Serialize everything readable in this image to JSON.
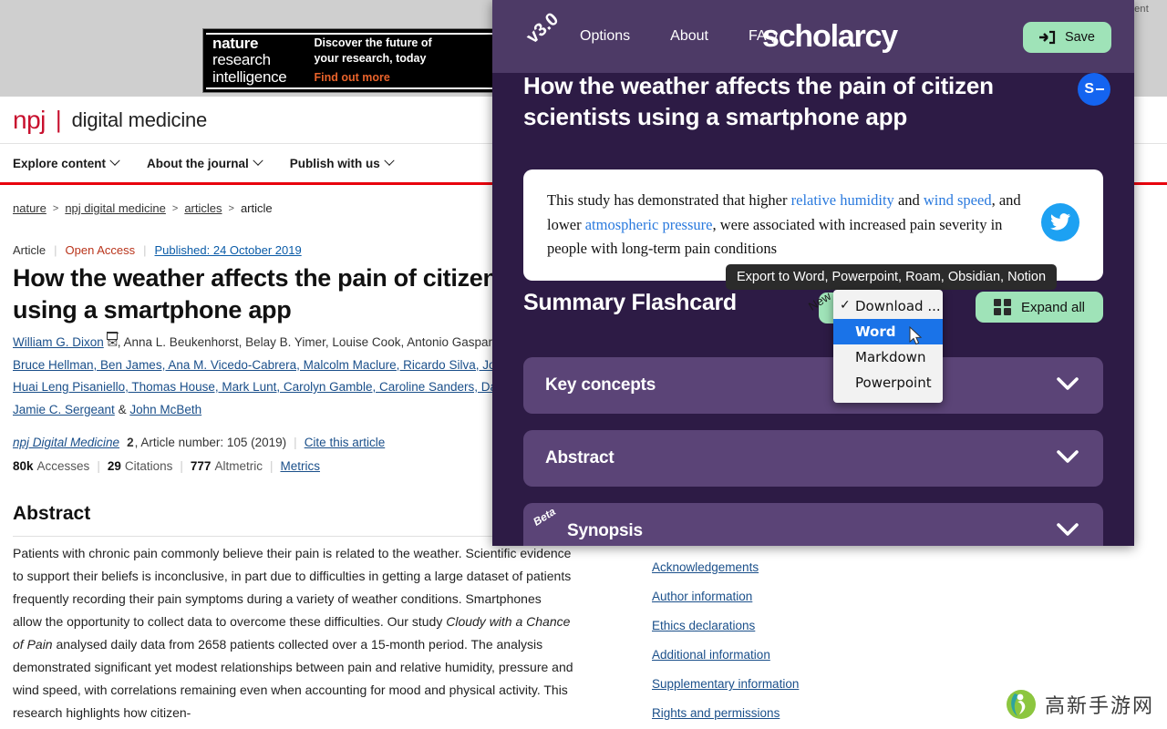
{
  "background": {
    "ad": {
      "label": "Advertisement",
      "brand_line1": "nature",
      "brand_line2": "research",
      "brand_line3": "intelligence",
      "headline_line1": "Discover the future of",
      "headline_line2": "your research, today",
      "cta": "Find out more"
    },
    "journal": {
      "logo": "npj",
      "name": "digital medicine",
      "nav": [
        "Explore content",
        "About the journal",
        "Publish with us"
      ],
      "accent_color": "#c8102e",
      "rule_color": "#e8000d"
    },
    "breadcrumb": [
      "nature",
      "npj digital medicine",
      "articles",
      "article"
    ],
    "article": {
      "type": "Article",
      "access": "Open Access",
      "published": "Published: 24 October 2019",
      "title": "How the weather affects the pain of citizen scientists using a smartphone app",
      "authors_line1": "William G. Dixon",
      "authors_rest1": ", Anna L. Beukenhorst, Belay B. Yimer, Louise Cook, Antonio Gasparrini,",
      "authors_line2": "Bruce Hellman, Ben James, Ana M. Vicedo-Cabrera, Malcolm Maclure, Ricardo Silva, John A",
      "authors_line3": "Huai Leng Pisaniello, Thomas House, Mark Lunt, Carolyn Gamble, Caroline Sanders, David N",
      "authors_line4a": "Jamie C. Sergeant",
      "authors_amp": " & ",
      "authors_line4b": "John McBeth",
      "citation_journal": "npj Digital Medicine",
      "citation_volume": "2",
      "citation_rest": ", Article number: 105 (2019)",
      "cite_link": "Cite this article",
      "accesses_value": "80k",
      "accesses_label": "Accesses",
      "citations_value": "29",
      "citations_label": "Citations",
      "altmetric_value": "777",
      "altmetric_label": "Altmetric",
      "metrics_link": "Metrics",
      "abstract_heading": "Abstract",
      "abstract_text_1": "Patients with chronic pain commonly believe their pain is related to the weather. Scientific evidence to support their beliefs is inconclusive, in part due to difficulties in getting a large dataset of patients frequently recording their pain symptoms during a variety of weather conditions. Smartphones allow the opportunity to collect data to overcome these difficulties. Our study ",
      "abstract_italic": "Cloudy with a Chance of Pain",
      "abstract_text_2": " analysed daily data from 2658 patients collected over a 15-month period. The analysis demonstrated significant yet modest relationships between pain and relative humidity, pressure and wind speed, with correlations remaining even when accounting for mood and physical activity. This research highlights how citizen-"
    },
    "side_links": [
      "Acknowledgements",
      "Author information",
      "Ethics declarations",
      "Additional information",
      "Supplementary information",
      "Rights and permissions"
    ],
    "watermark_text": "高新手游网"
  },
  "scholarcy": {
    "version": "v3.0",
    "nav": [
      "Options",
      "About",
      "FAQ"
    ],
    "brand": "scholarcy",
    "save_label": "Save",
    "badge_letter": "S",
    "paper_title": "How the weather affects the pain of citizen scientists using a smartphone app",
    "key_takeaway": {
      "t1": "This study has demonstrated that higher ",
      "h1": "relative humidity",
      "t2": " and ",
      "h2": "wind speed",
      "t3": ", and lower ",
      "h3": "atmospheric pressure",
      "t4": ", were associated with increased pain severity in people with long-term pain conditions"
    },
    "section_title": "Summary Flashcard",
    "new_badge": "New",
    "expand_label": "Expand all",
    "tooltip": "Export to Word, Powerpoint, Roam, Obsidian, Notion",
    "dropdown": {
      "items": [
        "Download ...",
        "Word",
        "Markdown",
        "Powerpoint"
      ],
      "checked_index": 0,
      "selected_index": 1,
      "highlight_color": "#1a73e8"
    },
    "accordions": [
      {
        "label": "Key concepts",
        "badge": ""
      },
      {
        "label": "Abstract",
        "badge": ""
      },
      {
        "label": "Synopsis",
        "badge": "Beta"
      }
    ],
    "colors": {
      "panel_bg": "#2d1b45",
      "topbar_bg": "#4d3a66",
      "accent_green": "#9fe3b8",
      "accordion_bg": "#5b4477",
      "link_blue": "#2a7ade",
      "badge_blue": "#1464f0",
      "twitter_blue": "#1da1f2"
    }
  }
}
